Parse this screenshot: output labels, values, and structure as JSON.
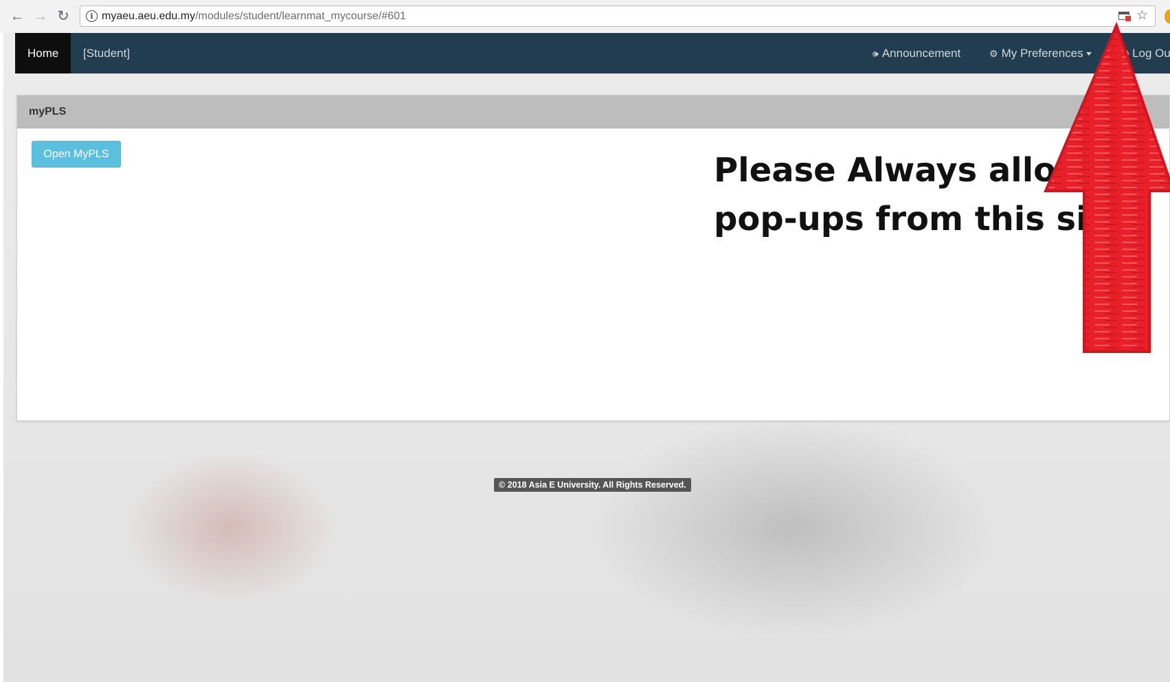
{
  "browser": {
    "url_host": "myaeu.aeu.edu.my",
    "url_path": "/modules/student/learnmat_mycourse/#601",
    "back_icon": "arrow-left-icon",
    "forward_icon": "arrow-right-icon",
    "reload_icon": "reload-icon",
    "info_icon": "info-icon",
    "popup_blocked_icon": "popup-blocked-icon",
    "bookmark_icon": "star-icon"
  },
  "navbar": {
    "home": "Home",
    "role": "[Student]",
    "announcement": "Announcement",
    "preferences": "My Preferences",
    "logout": "Log Ou",
    "bg_color": "#233d50"
  },
  "panel": {
    "title": "myPLS",
    "open_button": "Open MyPLS"
  },
  "annotation": {
    "line1": "Please Always allow",
    "line2": "pop-ups from this site",
    "arrow_color": "#e8202a"
  },
  "footer": {
    "copyright": "© 2018 Asia E University. All Rights Reserved."
  }
}
